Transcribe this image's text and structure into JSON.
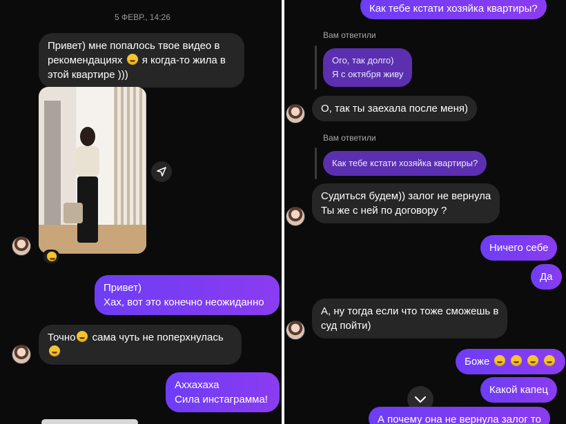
{
  "left": {
    "timestamp": "5 ФЕВР., 14:26",
    "msg1": [
      "Привет) мне попалось твое видео в",
      "рекомендациях",
      "я когда-то жила в",
      "этой квартире )))"
    ],
    "msg_out1": [
      "Привет)",
      "Хах, вот это конечно неожиданно"
    ],
    "msg2": [
      "Точно",
      "сама чуть не поперхнулась"
    ],
    "msg_out2": [
      "Аххахаха",
      "Сила инстаграмма!"
    ]
  },
  "right": {
    "top_cut": "Как тебе кстати хозяйка квартиры?",
    "replied_label_1": "Вам ответили",
    "reply_quote_1": [
      "Ого, так долго)",
      "Я с октября живу"
    ],
    "msg1": "О, так ты заехала после меня)",
    "replied_label_2": "Вам ответили",
    "reply_quote_2": "Как тебе кстати хозяйка квартиры?",
    "msg2": [
      "Судиться будем)) залог не вернула",
      "Ты же с ней по договору ?"
    ],
    "out1": "Ничего себе",
    "out2": "Да",
    "msg3": [
      "А, ну тогда если что тоже сможешь в",
      "суд пойти)"
    ],
    "out3": "Боже",
    "out4": "Какой капец",
    "out5_cut": "А почему она не вернула залог то"
  },
  "colors": {
    "bg": "#0b0b0b",
    "incoming": "#262626",
    "outgoing": "#7c3aed",
    "reply": "#5b2fb0"
  },
  "icons": [
    "avatar",
    "share-icon",
    "reaction-emoji",
    "scroll-down-icon",
    "laughing-emoji",
    "rofl-emoji"
  ]
}
